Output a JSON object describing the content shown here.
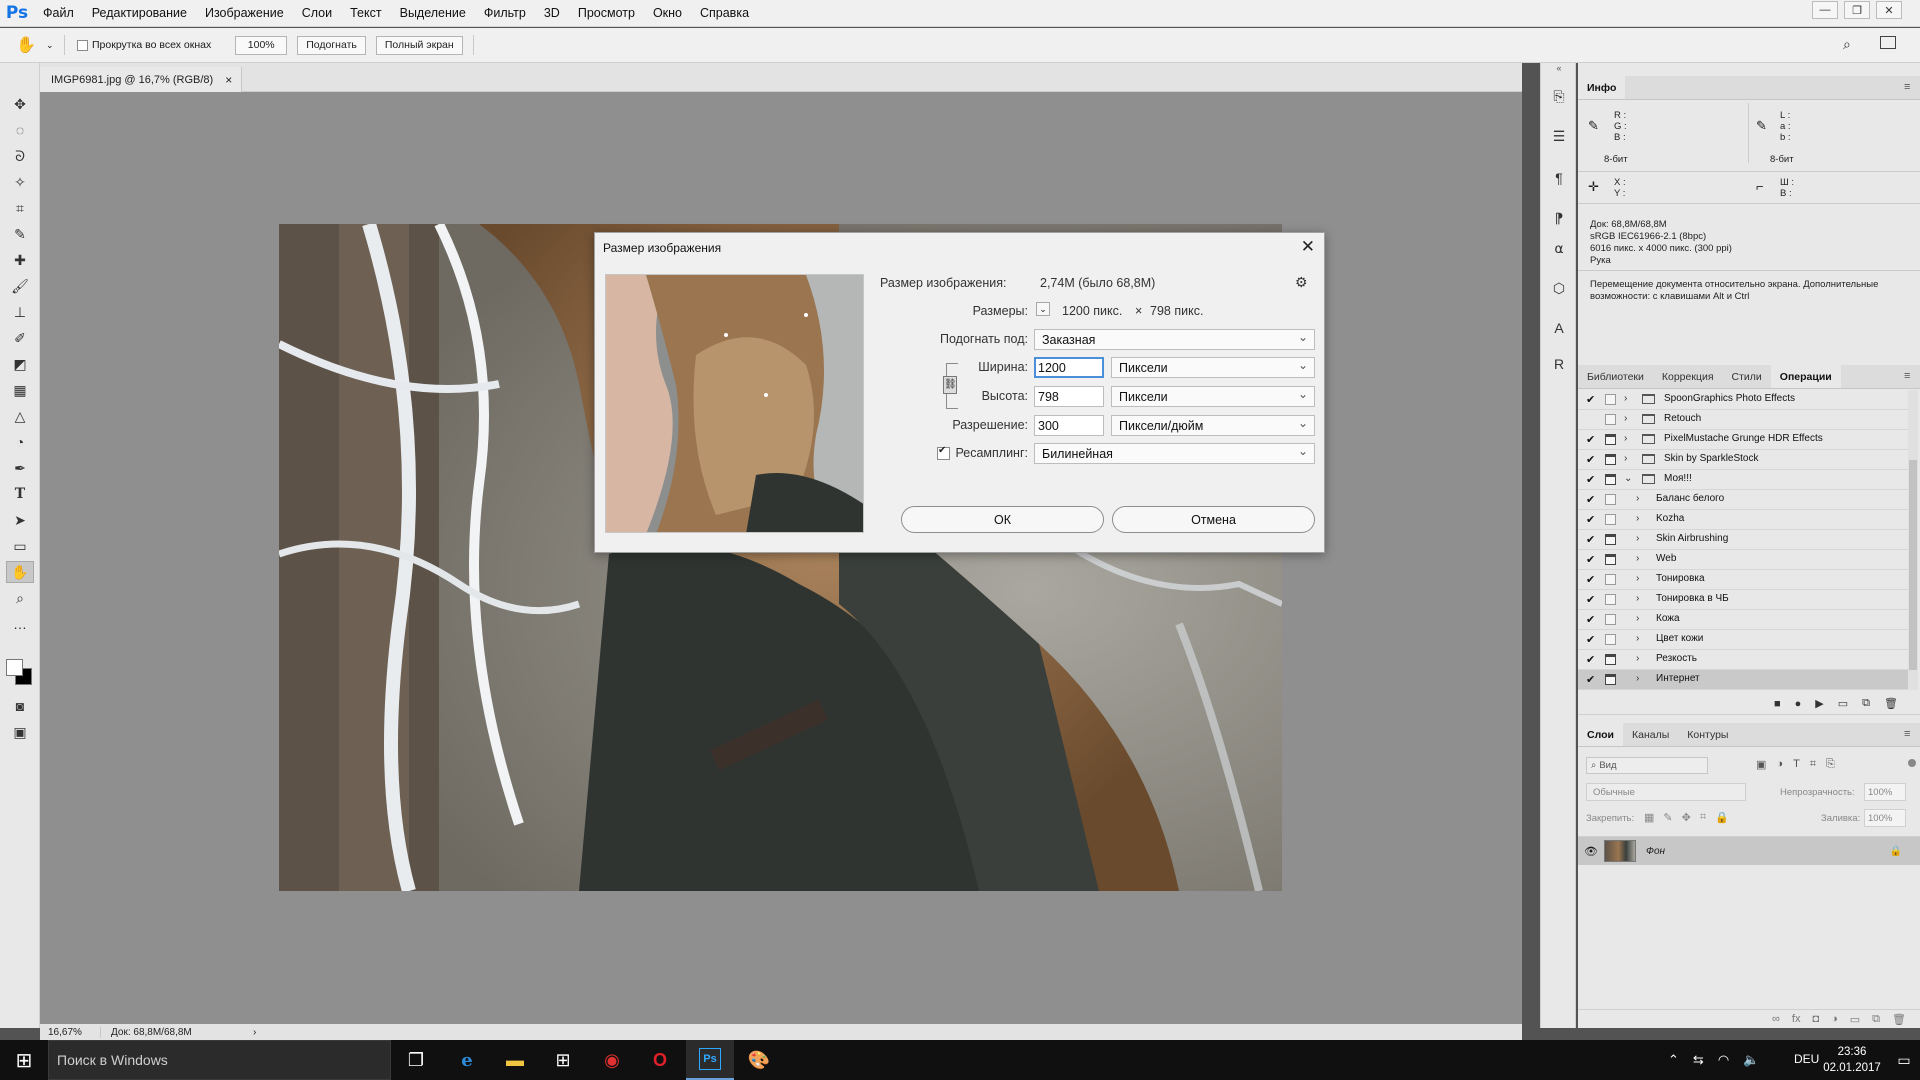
{
  "app": {
    "logo": "Ps"
  },
  "menu": [
    "Файл",
    "Редактирование",
    "Изображение",
    "Слои",
    "Текст",
    "Выделение",
    "Фильтр",
    "3D",
    "Просмотр",
    "Окно",
    "Справка"
  ],
  "options_bar": {
    "scroll_all_label": "Прокрутка во всех окнах",
    "zoom_100_label": "100%",
    "fit_label": "Подогнать",
    "fullscreen_label": "Полный экран"
  },
  "document_tab": {
    "title": "IMGP6981.jpg @ 16,7% (RGB/8)",
    "close": "×"
  },
  "status_bar": {
    "zoom": "16,67%",
    "doc_info": "Док: 68,8M/68,8M",
    "arrow": "›"
  },
  "dialog": {
    "title": "Размер изображения",
    "image_size_label": "Размер изображения:",
    "image_size_value": "2,74M (было 68,8M)",
    "dimensions_label": "Размеры:",
    "dimensions_w": "1200 пикс.",
    "dimensions_x": "×",
    "dimensions_h": "798 пикс.",
    "fit_to_label": "Подогнать под:",
    "fit_to_value": "Заказная",
    "width_label": "Ширина:",
    "width_value": "1200",
    "width_unit": "Пиксели",
    "height_label": "Высота:",
    "height_value": "798",
    "height_unit": "Пиксели",
    "resolution_label": "Разрешение:",
    "resolution_value": "300",
    "resolution_unit": "Пиксели/дюйм",
    "resample_label": "Ресамплинг:",
    "resample_value": "Билинейная",
    "ok_label": "ОК",
    "cancel_label": "Отмена"
  },
  "info_panel": {
    "tab": "Инфо",
    "rgb_labels": "R :\nG :\nB :",
    "lab_labels": "L :\na :\nb :",
    "bit_left": "8-бит",
    "bit_right": "8-бит",
    "xy_labels": "X :\nY :",
    "wh_labels": "Ш :\nВ :",
    "doc_line1": "Док: 68,8M/68,8M",
    "doc_line2": "sRGB IEC61966-2.1 (8bpc)",
    "doc_line3": "6016 пикс. x 4000 пикс. (300 ppi)",
    "doc_line4": "Рука",
    "hint": "Перемещение документа относительно экрана. Дополнительные возможности: с клавишами Alt и Ctrl"
  },
  "actions_panel": {
    "tabs": [
      "Библиотеки",
      "Коррекция",
      "Стили",
      "Операции"
    ],
    "rows": [
      {
        "label": "SpoonGraphics Photo Effects",
        "check": "✔",
        "dialog": false,
        "folder": true,
        "level": 0,
        "open": false
      },
      {
        "label": "Retouch",
        "check": "",
        "dialog": false,
        "folder": true,
        "level": 0,
        "open": false
      },
      {
        "label": "PixelMustache Grunge HDR Effects",
        "check": "✔",
        "dialog": true,
        "folder": true,
        "level": 0,
        "open": false
      },
      {
        "label": "Skin by SparkleStock",
        "check": "✔",
        "dialog": true,
        "folder": true,
        "level": 0,
        "open": false
      },
      {
        "label": "Моя!!!",
        "check": "✔",
        "dialog": true,
        "folder": true,
        "level": 0,
        "open": true
      },
      {
        "label": "Баланс белого",
        "check": "✔",
        "dialog": false,
        "folder": false,
        "level": 1,
        "open": false
      },
      {
        "label": "Kozha",
        "check": "✔",
        "dialog": false,
        "folder": false,
        "level": 1,
        "open": false
      },
      {
        "label": "Skin Airbrushing",
        "check": "✔",
        "dialog": true,
        "folder": false,
        "level": 1,
        "open": false
      },
      {
        "label": "Web",
        "check": "✔",
        "dialog": true,
        "folder": false,
        "level": 1,
        "open": false
      },
      {
        "label": "Тонировка",
        "check": "✔",
        "dialog": false,
        "folder": false,
        "level": 1,
        "open": false
      },
      {
        "label": "Тонировка в ЧБ",
        "check": "✔",
        "dialog": false,
        "folder": false,
        "level": 1,
        "open": false
      },
      {
        "label": "Кожа",
        "check": "✔",
        "dialog": false,
        "folder": false,
        "level": 1,
        "open": false
      },
      {
        "label": "Цвет кожи",
        "check": "✔",
        "dialog": false,
        "folder": false,
        "level": 1,
        "open": false
      },
      {
        "label": "Резкость",
        "check": "✔",
        "dialog": true,
        "folder": false,
        "level": 1,
        "open": false
      },
      {
        "label": "Интернет",
        "check": "✔",
        "dialog": true,
        "folder": false,
        "level": 1,
        "open": false
      }
    ]
  },
  "layers_panel": {
    "tabs": [
      "Слои",
      "Каналы",
      "Контуры"
    ],
    "filter_placeholder": "Вид",
    "blend_mode": "Обычные",
    "opacity_label": "Непрозрачность:",
    "opacity_value": "100%",
    "lock_label": "Закрепить:",
    "fill_label": "Заливка:",
    "fill_value": "100%",
    "layer_name": "Фон"
  },
  "taskbar": {
    "search_placeholder": "Поиск в Windows",
    "lang": "DEU",
    "time": "23:36",
    "date": "02.01.2017"
  }
}
